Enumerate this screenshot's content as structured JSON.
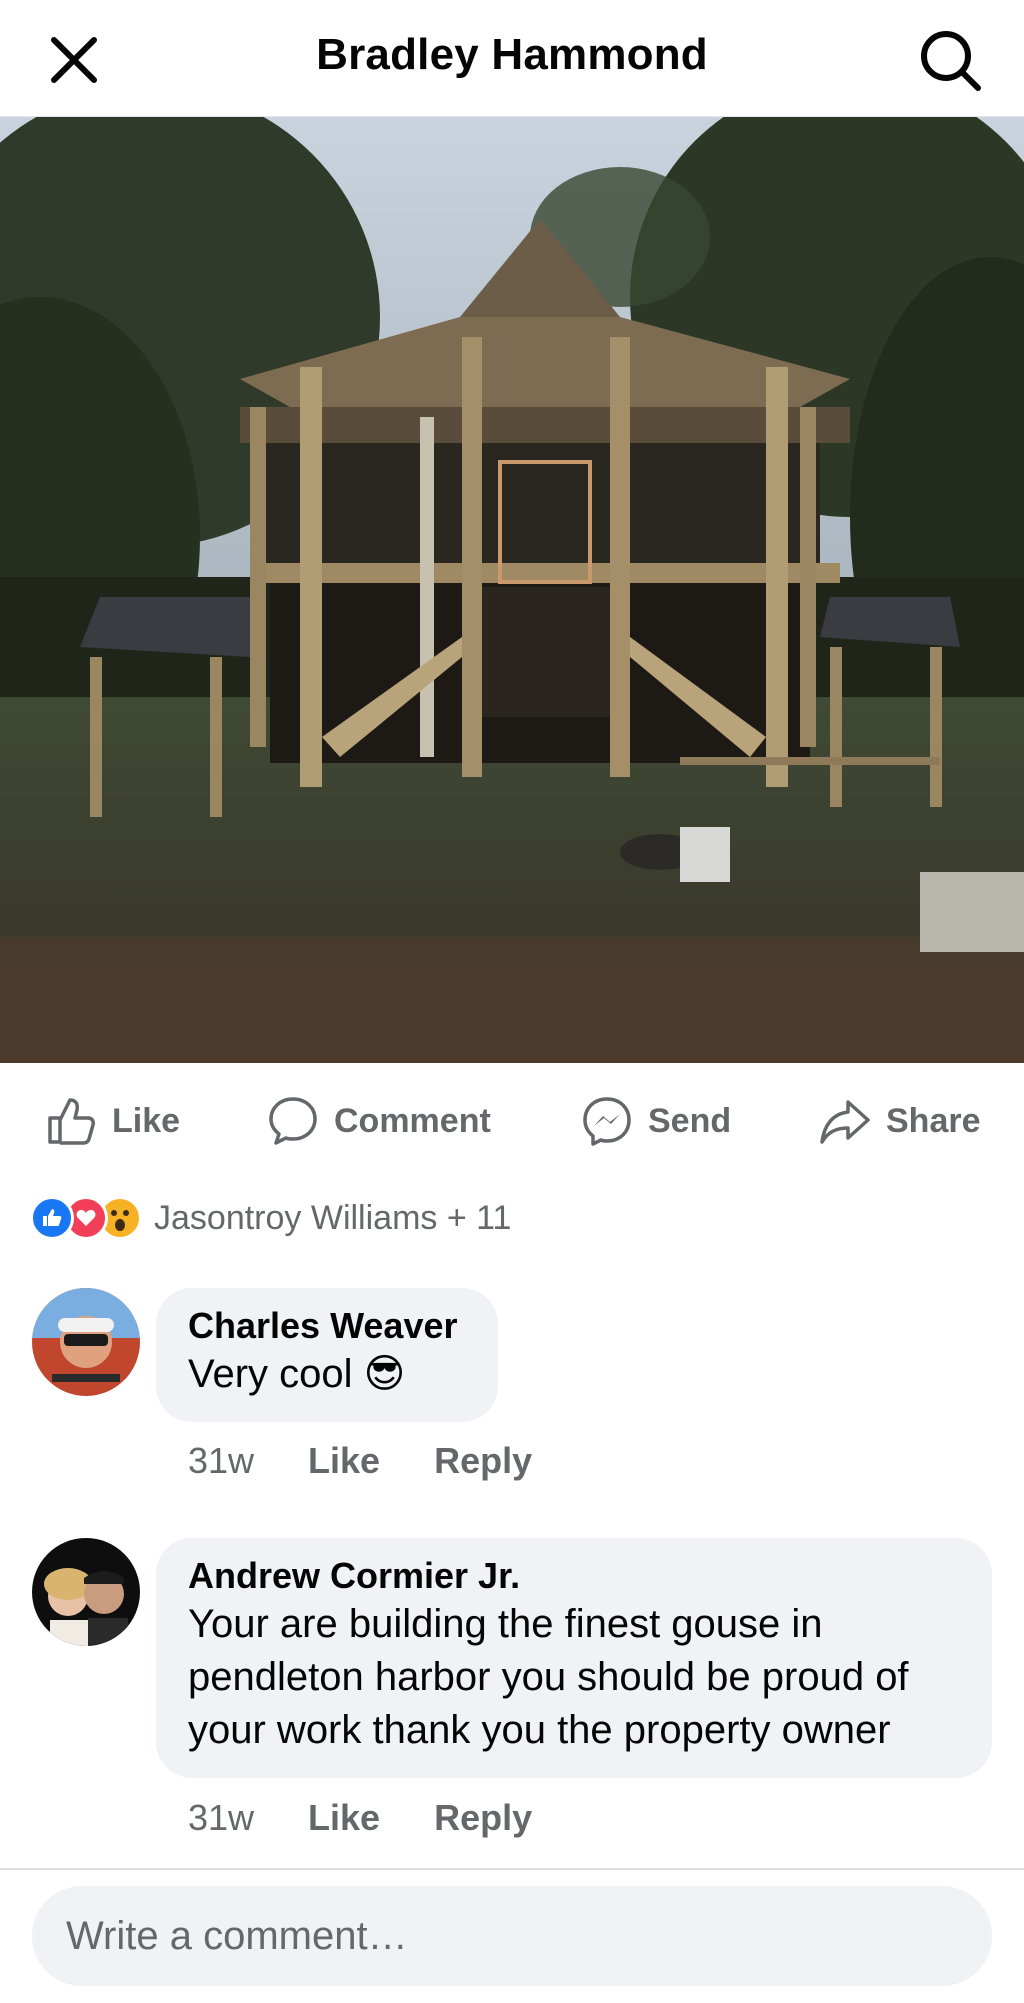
{
  "header": {
    "title": "Bradley Hammond",
    "close_icon": "close-icon",
    "search_icon": "search-icon"
  },
  "photo": {
    "subject": "construction-photo"
  },
  "actions": {
    "like": "Like",
    "comment": "Comment",
    "send": "Send",
    "share": "Share"
  },
  "reactions": {
    "types": [
      "like",
      "love",
      "wow"
    ],
    "summary": "Jasontroy Williams + 11"
  },
  "comments": [
    {
      "author": "Charles Weaver",
      "text": "Very cool",
      "emoji": "😎",
      "time": "31w",
      "like": "Like",
      "reply": "Reply"
    },
    {
      "author": "Andrew Cormier Jr.",
      "lines": [
        "Your are building the finest gouse in",
        "pendleton harbor you should be proud of",
        "your work thank you the property owner"
      ],
      "time": "31w",
      "like": "Like",
      "reply": "Reply"
    }
  ],
  "composer": {
    "placeholder": "Write a comment…"
  },
  "colors": {
    "accent": "#1877f2",
    "muted_text": "#65676b",
    "bubble_bg": "#f0f2f5"
  }
}
